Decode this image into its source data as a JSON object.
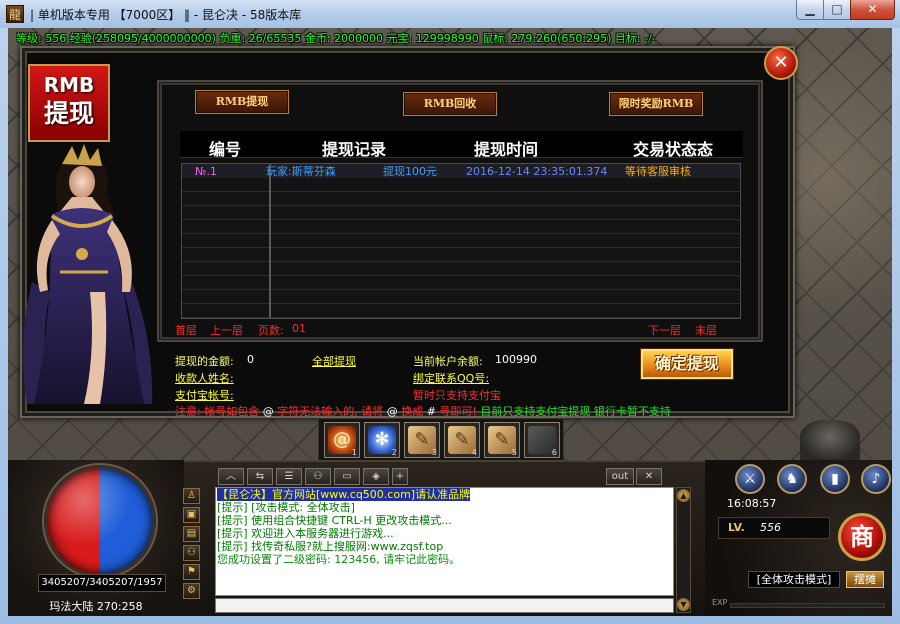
{
  "window": {
    "app_icon_glyph": "龍",
    "title": "| 单机版本专用 【7000区】 ‖ - 昆仑决 - 58版本库"
  },
  "status_bar": {
    "text": "等级: 556 经验(258095/4000000000) 负重: 26/65535 金币: 2000000 元宝: 129998990 鼠标: 279:260(650:295) 目标: -/-"
  },
  "dialog": {
    "badge": {
      "line1": "RMB",
      "line2": "提现"
    },
    "tabs": [
      {
        "label": "RMB提现"
      },
      {
        "label": "RMB回收"
      },
      {
        "label": "限时奖励RMB"
      }
    ],
    "table": {
      "columns": [
        "编号",
        "提现记录",
        "提现时间",
        "交易状态态"
      ],
      "rows": [
        {
          "id": "№.1",
          "record": "玩家:斯蒂芬森",
          "amount": "提现100元",
          "time": "2016-12-14 23:35:01.374",
          "status": "等待客服审核"
        }
      ]
    },
    "pagination": {
      "first": "首层",
      "prev": "上一层",
      "page_label": "页数:",
      "page": "01",
      "next": "下一层",
      "last": "末层"
    },
    "form": {
      "amount_label": "提现的金额:",
      "amount_value": "0",
      "withdraw_all": "全部提现",
      "balance_label": "当前帐户余额:",
      "balance_value": "100990",
      "payee_label": "收款人姓名:",
      "qq_label": "绑定联系QQ号:",
      "alipay_label": "支付宝帐号:",
      "alipay_only": "暂时只支持支付宝",
      "confirm": "确定提现"
    },
    "notice": [
      {
        "text": "注意: 帐号如包含 ",
        "color": "#ff2a2a"
      },
      {
        "text": "@",
        "color": "#ffffff"
      },
      {
        "text": " 字符无法输入的, 请将 ",
        "color": "#ff2a2a"
      },
      {
        "text": "@",
        "color": "#ffffff"
      },
      {
        "text": " 换成 ",
        "color": "#ff2a2a"
      },
      {
        "text": "#",
        "color": "#ffffff"
      },
      {
        "text": " 号即可! ",
        "color": "#ff2a2a"
      },
      {
        "text": "目前只支持支付宝提现 银行卡暂不支持",
        "color": "#22dd22"
      }
    ]
  },
  "skills": [
    {
      "key": "1",
      "icon": "fire-spiral-icon"
    },
    {
      "key": "2",
      "icon": "ice-swirl-icon"
    },
    {
      "key": "3",
      "icon": "scroll-icon"
    },
    {
      "key": "4",
      "icon": "scroll-icon"
    },
    {
      "key": "5",
      "icon": "scroll-icon"
    },
    {
      "key": "6",
      "icon": "empty-slot"
    }
  ],
  "hud": {
    "hp_mp": "3405207/3405207/1957",
    "map": "玛法大陆 270:258"
  },
  "chat": {
    "out_label": "out",
    "lines": [
      {
        "text": "【昆仑决】官方网站[www.cq500.com]请认准品牌",
        "color": "#ffff00",
        "highlight": "#1e2fa8"
      },
      {
        "text": "[提示] [攻击模式: 全体攻击]",
        "color": "#007a00",
        "highlight": "transparent"
      },
      {
        "text": "[提示] 使用组合快捷键 CTRL-H 更改攻击模式...",
        "color": "#007a00",
        "highlight": "transparent"
      },
      {
        "text": "[提示] 欢迎进入本服务器进行游戏...",
        "color": "#007a00",
        "highlight": "transparent"
      },
      {
        "text": "[提示] 找传奇私服?就上搜服网:www.zqsf.top",
        "color": "#007a00",
        "highlight": "transparent"
      },
      {
        "text": "您成功设置了二级密码: 123456, 请牢记此密码。",
        "color": "#0a8a0a",
        "highlight": "transparent"
      }
    ]
  },
  "right_panel": {
    "time": "16:08:57",
    "level_label": "LV.",
    "level": "556",
    "shop": "商",
    "attack_mode": "[全体攻击模式]",
    "stall": "摆摊",
    "exp_label": "EXP"
  },
  "colors": {
    "status_text": "#22ff22",
    "badge_red": "#d31616",
    "hp": "#d81b1b",
    "mp": "#1f5ed8",
    "accent_gold": "#c9a24a"
  }
}
